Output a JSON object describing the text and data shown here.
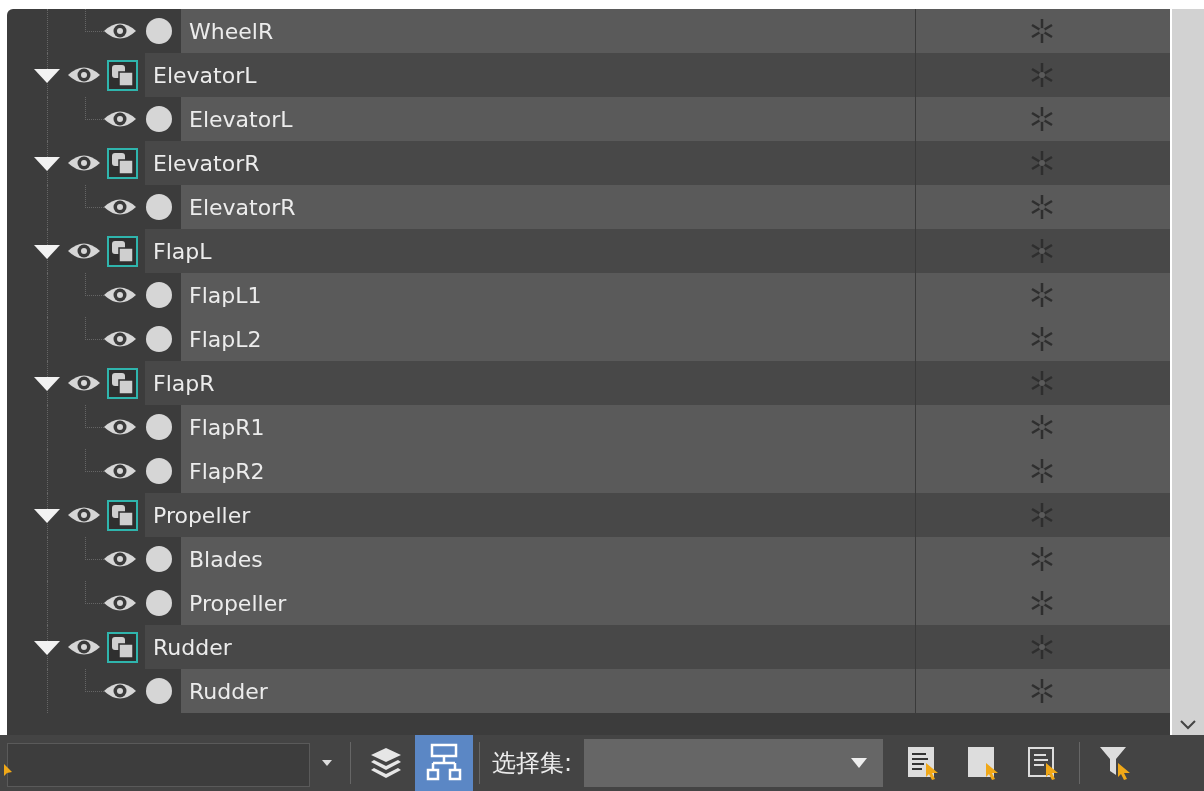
{
  "scene_tree": [
    {
      "kind": "scrolled_out",
      "children": [
        {
          "kind": "object",
          "name": "WheelR",
          "visible": true
        }
      ]
    },
    {
      "kind": "group",
      "name": "ElevatorL",
      "visible": true,
      "expanded": true,
      "children": [
        {
          "kind": "object",
          "name": "ElevatorL",
          "visible": true
        }
      ]
    },
    {
      "kind": "group",
      "name": "ElevatorR",
      "visible": true,
      "expanded": true,
      "children": [
        {
          "kind": "object",
          "name": "ElevatorR",
          "visible": true
        }
      ]
    },
    {
      "kind": "group",
      "name": "FlapL",
      "visible": true,
      "expanded": true,
      "children": [
        {
          "kind": "object",
          "name": "FlapL1",
          "visible": true
        },
        {
          "kind": "object",
          "name": "FlapL2",
          "visible": true
        }
      ]
    },
    {
      "kind": "group",
      "name": "FlapR",
      "visible": true,
      "expanded": true,
      "children": [
        {
          "kind": "object",
          "name": "FlapR1",
          "visible": true
        },
        {
          "kind": "object",
          "name": "FlapR2",
          "visible": true
        }
      ]
    },
    {
      "kind": "group",
      "name": "Propeller",
      "visible": true,
      "expanded": true,
      "children": [
        {
          "kind": "object",
          "name": "Blades",
          "visible": true
        },
        {
          "kind": "object",
          "name": "Propeller",
          "visible": true
        }
      ]
    },
    {
      "kind": "group",
      "name": "Rudder",
      "visible": true,
      "expanded": true,
      "children": [
        {
          "kind": "object",
          "name": "Rudder",
          "visible": true
        }
      ]
    }
  ],
  "toolbar": {
    "view_buttons": [
      {
        "kind": "layers",
        "selected": false
      },
      {
        "kind": "hierarchy",
        "selected": true
      }
    ],
    "selection_set_label": "选择集:"
  }
}
